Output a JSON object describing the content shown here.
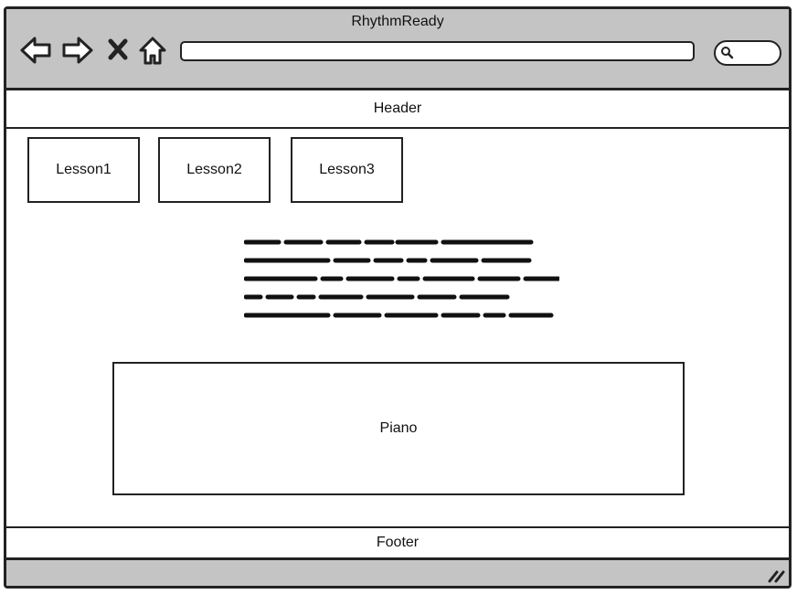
{
  "window": {
    "title": "RhythmReady"
  },
  "toolbar": {
    "icons": [
      "back-arrow-icon",
      "forward-arrow-icon",
      "close-icon",
      "home-icon",
      "search-icon"
    ]
  },
  "page": {
    "header": "Header",
    "lessons": [
      "Lesson1",
      "Lesson2",
      "Lesson3"
    ],
    "piano": "Piano",
    "footer": "Footer"
  },
  "colors": {
    "chrome": "#c4c4c4",
    "stroke": "#222222",
    "background": "#ffffff"
  }
}
